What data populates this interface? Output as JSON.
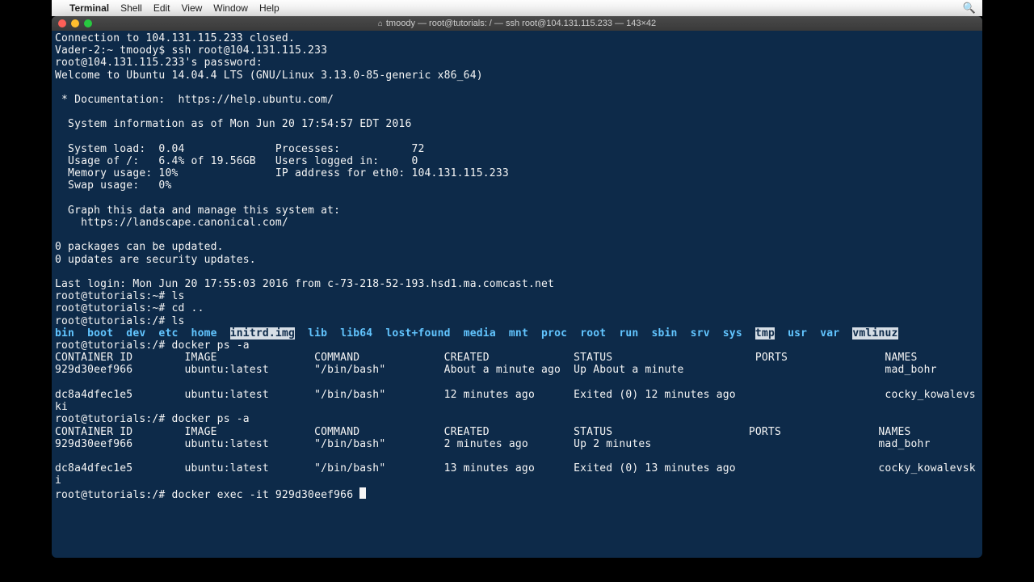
{
  "menubar": {
    "app": "Terminal",
    "items": [
      "Shell",
      "Edit",
      "View",
      "Window",
      "Help"
    ]
  },
  "window": {
    "title": "tmoody — root@tutorials: / — ssh root@104.131.115.233 — 143×42"
  },
  "term": {
    "line01": "Connection to 104.131.115.233 closed.",
    "line02": "Vader-2:~ tmoody$ ssh root@104.131.115.233",
    "line03": "root@104.131.115.233's password:",
    "line04": "Welcome to Ubuntu 14.04.4 LTS (GNU/Linux 3.13.0-85-generic x86_64)",
    "line05": "",
    "line06": " * Documentation:  https://help.ubuntu.com/",
    "line07": "",
    "line08": "  System information as of Mon Jun 20 17:54:57 EDT 2016",
    "line09": "",
    "line10": "  System load:  0.04              Processes:           72",
    "line11": "  Usage of /:   6.4% of 19.56GB   Users logged in:     0",
    "line12": "  Memory usage: 10%               IP address for eth0: 104.131.115.233",
    "line13": "  Swap usage:   0%",
    "line14": "",
    "line15": "  Graph this data and manage this system at:",
    "line16": "    https://landscape.canonical.com/",
    "line17": "",
    "line18": "0 packages can be updated.",
    "line19": "0 updates are security updates.",
    "line20": "",
    "line21": "Last login: Mon Jun 20 17:55:03 2016 from c-73-218-52-193.hsd1.ma.comcast.net",
    "line22": "root@tutorials:~# ls",
    "line23": "root@tutorials:~# cd ..",
    "line24": "root@tutorials:/# ls",
    "ls": {
      "pre": "bin  boot  dev  etc  home  ",
      "initrd": "initrd.img",
      "mid": "  lib  lib64  lost+found  media  mnt  proc  root  run  sbin  srv  sys  ",
      "tmp": "tmp",
      "post": "  usr  var  ",
      "vmlinuz": "vmlinuz"
    },
    "line25": "root@tutorials:/# docker ps -a",
    "hdr1": "CONTAINER ID        IMAGE               COMMAND             CREATED             STATUS                      PORTS               NAMES",
    "row1a": "929d30eef966        ubuntu:latest       \"/bin/bash\"         About a minute ago  Up About a minute                               mad_bohr",
    "row1b": "",
    "row1c": "dc8a4dfec1e5        ubuntu:latest       \"/bin/bash\"         12 minutes ago      Exited (0) 12 minutes ago                       cocky_kowalevs",
    "row1cw": "ki",
    "line26": "root@tutorials:/# docker ps -a",
    "hdr2": "CONTAINER ID        IMAGE               COMMAND             CREATED             STATUS                     PORTS               NAMES",
    "row2a": "929d30eef966        ubuntu:latest       \"/bin/bash\"         2 minutes ago       Up 2 minutes                                   mad_bohr",
    "row2b": "",
    "row2c": "dc8a4dfec1e5        ubuntu:latest       \"/bin/bash\"         13 minutes ago      Exited (0) 13 minutes ago                      cocky_kowalevsk",
    "row2cw": "i",
    "prompt": "root@tutorials:/# docker exec -it 929d30eef966 "
  }
}
